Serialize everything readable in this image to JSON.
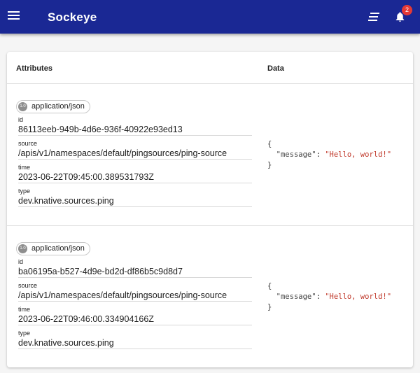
{
  "app": {
    "title": "Sockeye",
    "notification_count": "2"
  },
  "table": {
    "col_attributes": "Attributes",
    "col_data": "Data"
  },
  "events": [
    {
      "spec_version": "1.0",
      "content_type": "application/json",
      "id_label": "id",
      "id": "86113eeb-949b-4d6e-936f-40922e93ed13",
      "source_label": "source",
      "source": "/apis/v1/namespaces/default/pingsources/ping-source",
      "time_label": "time",
      "time": "2023-06-22T09:45:00.389531793Z",
      "type_label": "type",
      "type": "dev.knative.sources.ping",
      "data": {
        "open": "{",
        "key": "\"message\"",
        "sep": ": ",
        "value": "\"Hello, world!\"",
        "close": "}"
      }
    },
    {
      "spec_version": "1.0",
      "content_type": "application/json",
      "id_label": "id",
      "id": "ba06195a-b527-4d9e-bd2d-df86b5c9d8d7",
      "source_label": "source",
      "source": "/apis/v1/namespaces/default/pingsources/ping-source",
      "time_label": "time",
      "time": "2023-06-22T09:46:00.334904166Z",
      "type_label": "type",
      "type": "dev.knative.sources.ping",
      "data": {
        "open": "{",
        "key": "\"message\"",
        "sep": ": ",
        "value": "\"Hello, world!\"",
        "close": "}"
      }
    }
  ],
  "colors": {
    "appbar": "#1a2894",
    "badge": "#e53935",
    "json_string": "#c0392b"
  },
  "icons": {
    "menu": "menu-icon",
    "clear_all": "clear-all-icon",
    "notifications": "bell-icon"
  }
}
